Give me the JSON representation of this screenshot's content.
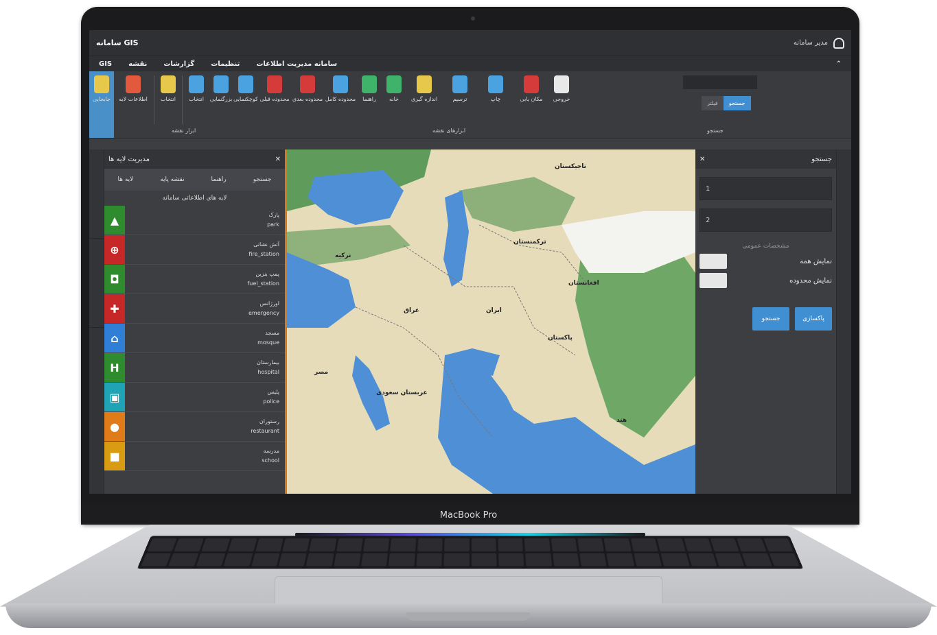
{
  "device": {
    "label": "MacBook Pro"
  },
  "app": {
    "title": "سامانه GIS",
    "user": "مدیر سامانه"
  },
  "menu": [
    "GIS",
    "نقشه",
    "گزارشات",
    "تنظیمات",
    "سامانه مدیریت اطلاعات"
  ],
  "ribbon": {
    "buttons": [
      {
        "label": "جابجایی",
        "color": "#e8c84a"
      },
      {
        "label": "اطلاعات لایه",
        "color": "#e2593d"
      },
      {
        "label": "انتخاب",
        "color": "#e8c84a"
      },
      {
        "label": "انتخاب",
        "color": "#4aa3e0"
      },
      {
        "label": "بزرگنمایی",
        "color": "#4aa3e0"
      },
      {
        "label": "کوچکنمایی",
        "color": "#4aa3e0"
      },
      {
        "label": "محدوده قبلی",
        "color": "#d63b3b"
      },
      {
        "label": "محدوده بعدی",
        "color": "#d63b3b"
      },
      {
        "label": "محدوده کامل",
        "color": "#4aa3e0"
      },
      {
        "label": "راهنما",
        "color": "#3fb36a"
      },
      {
        "label": "خانه",
        "color": "#3fb36a"
      },
      {
        "label": "اندازه گیری",
        "color": "#e8c84a"
      },
      {
        "label": "ترسیم",
        "color": "#4aa3e0"
      },
      {
        "label": "چاپ",
        "color": "#4aa3e0"
      },
      {
        "label": "مکان یابی",
        "color": "#d63b3b"
      },
      {
        "label": "خروجی",
        "color": "#e8e8e8"
      }
    ],
    "groups": [
      "ابزار نقشه",
      "ابزارهای نقشه",
      "جستجو"
    ],
    "segment": {
      "on": "جستجو",
      "off": "فیلتر"
    }
  },
  "left_panel": {
    "title": "مدیریت لایه ها",
    "tabs": [
      "لایه ها",
      "نقشه پایه",
      "راهنما",
      "جستجو"
    ],
    "subtitle": "لایه های اطلاعاتی سامانه",
    "layers": [
      {
        "fa": "پارک",
        "en": "park",
        "color": "#2e8b2e",
        "glyph": "▲"
      },
      {
        "fa": "آتش نشانی",
        "en": "fire_station",
        "color": "#c62828",
        "glyph": "⊕"
      },
      {
        "fa": "پمپ بنزین",
        "en": "fuel_station",
        "color": "#2e8b2e",
        "glyph": "◘"
      },
      {
        "fa": "اورژانس",
        "en": "emergency",
        "color": "#c62828",
        "glyph": "✚"
      },
      {
        "fa": "مسجد",
        "en": "mosque",
        "color": "#2f7fd6",
        "glyph": "⌂"
      },
      {
        "fa": "بیمارستان",
        "en": "hospital",
        "color": "#2e8b2e",
        "glyph": "H"
      },
      {
        "fa": "پلیس",
        "en": "police",
        "color": "#1fa3b5",
        "glyph": "▣"
      },
      {
        "fa": "رستوران",
        "en": "restaurant",
        "color": "#e07b1a",
        "glyph": "●"
      },
      {
        "fa": "مدرسه",
        "en": "school",
        "color": "#d89b12",
        "glyph": "■"
      }
    ]
  },
  "map": {
    "labels": [
      "ایران",
      "عربستان سعودی",
      "ترکیه",
      "افغانستان",
      "پاکستان",
      "هند",
      "عراق",
      "مصر",
      "ترکمنستان",
      "تاجیکستان"
    ]
  },
  "right_panel": {
    "title": "جستجو",
    "field_1": "1",
    "field_2": "2",
    "section": "مشخصات عمومی",
    "check_1": "نمایش همه",
    "check_2": "نمایش محدوده",
    "btn_search": "جستجو",
    "btn_clear": "پاکسازی"
  }
}
